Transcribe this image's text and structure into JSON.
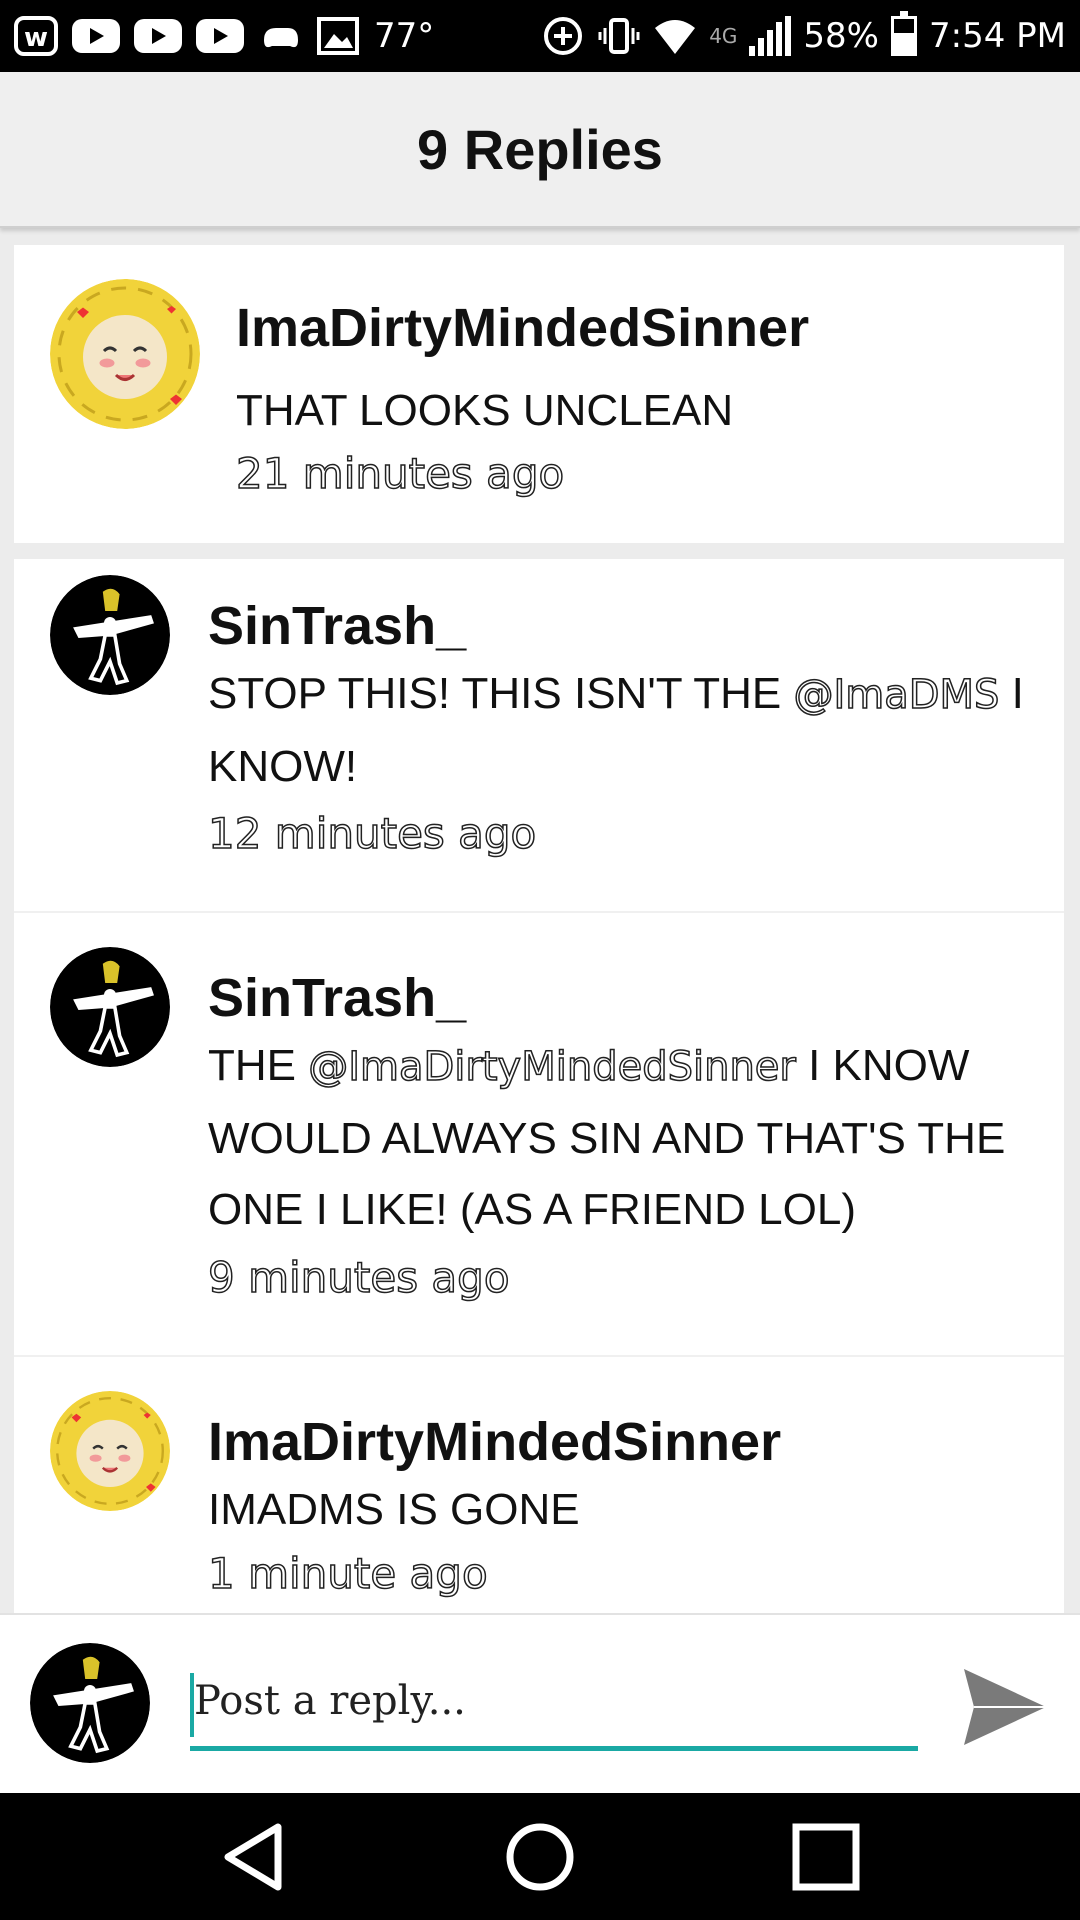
{
  "status_bar": {
    "temperature": "77°",
    "network": "4G",
    "battery_percent": "58%",
    "battery_level": 0.58,
    "time": "7:54 PM"
  },
  "header": {
    "title": "9 Replies"
  },
  "replies": [
    {
      "username": "ImaDirtyMindedSinner",
      "message_parts": [
        "THAT LOOKS UNCLEAN"
      ],
      "time": "21 minutes ago",
      "avatar": "flowey-avatar"
    },
    {
      "username": "SinTrash_",
      "message_parts": [
        "STOP THIS! THIS ISN'T THE ",
        "@ImaDMS",
        " I KNOW!"
      ],
      "time": "12 minutes ago",
      "avatar": "dark-character-avatar"
    },
    {
      "username": "SinTrash_",
      "message_parts": [
        "THE ",
        "@ImaDirtyMindedSinner",
        " I KNOW WOULD ALWAYS SIN AND THAT'S THE ONE I LIKE! (AS A FRIEND LOL)"
      ],
      "time": "9 minutes ago",
      "avatar": "dark-character-avatar"
    },
    {
      "username": "ImaDirtyMindedSinner",
      "message_parts": [
        "IMADMS IS GONE"
      ],
      "time": "1 minute ago",
      "avatar": "flowey-avatar"
    }
  ],
  "composer": {
    "placeholder": "Post a reply...",
    "send_icon": "send-icon"
  },
  "colors": {
    "accent": "#1aa9a4",
    "header_bg": "#efefef",
    "card_bg": "#ffffff"
  },
  "nav": {
    "back_icon": "back-icon",
    "home_icon": "home-icon",
    "recents_icon": "recents-icon"
  }
}
